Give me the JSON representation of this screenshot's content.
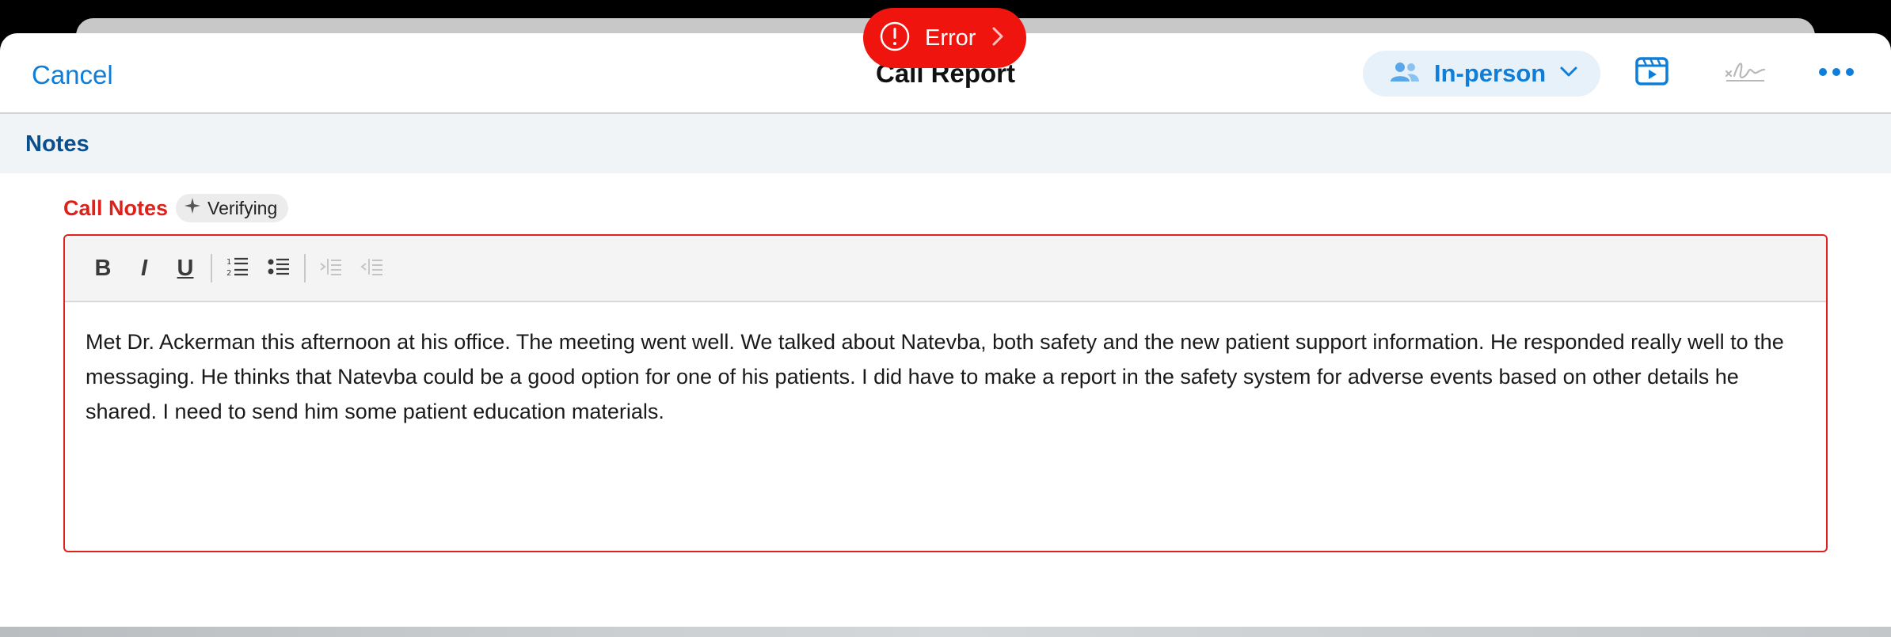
{
  "header": {
    "cancel_label": "Cancel",
    "title": "Call Report",
    "mode_label": "In-person",
    "accent_color": "#0e7ed8"
  },
  "error_toast": {
    "label": "Error",
    "color": "#f0140f"
  },
  "section": {
    "title": "Notes"
  },
  "field": {
    "label": "Call Notes",
    "badge_label": "Verifying",
    "error_color": "#e0201a"
  },
  "toolbar": {
    "bold": "B",
    "italic": "I",
    "underline": "U",
    "icons": [
      "bold-icon",
      "italic-icon",
      "underline-icon",
      "numbered-list-icon",
      "bulleted-list-icon",
      "indent-icon",
      "outdent-icon"
    ]
  },
  "notes_text": "Met Dr. Ackerman this afternoon at his office. The meeting went well. We talked about Natevba, both safety and the new patient support information. He responded really well to the messaging. He thinks that Natevba could be a good option for one of his patients. I did have to make a report in the safety system for adverse events based on other details he shared. I need to send him some patient education materials."
}
